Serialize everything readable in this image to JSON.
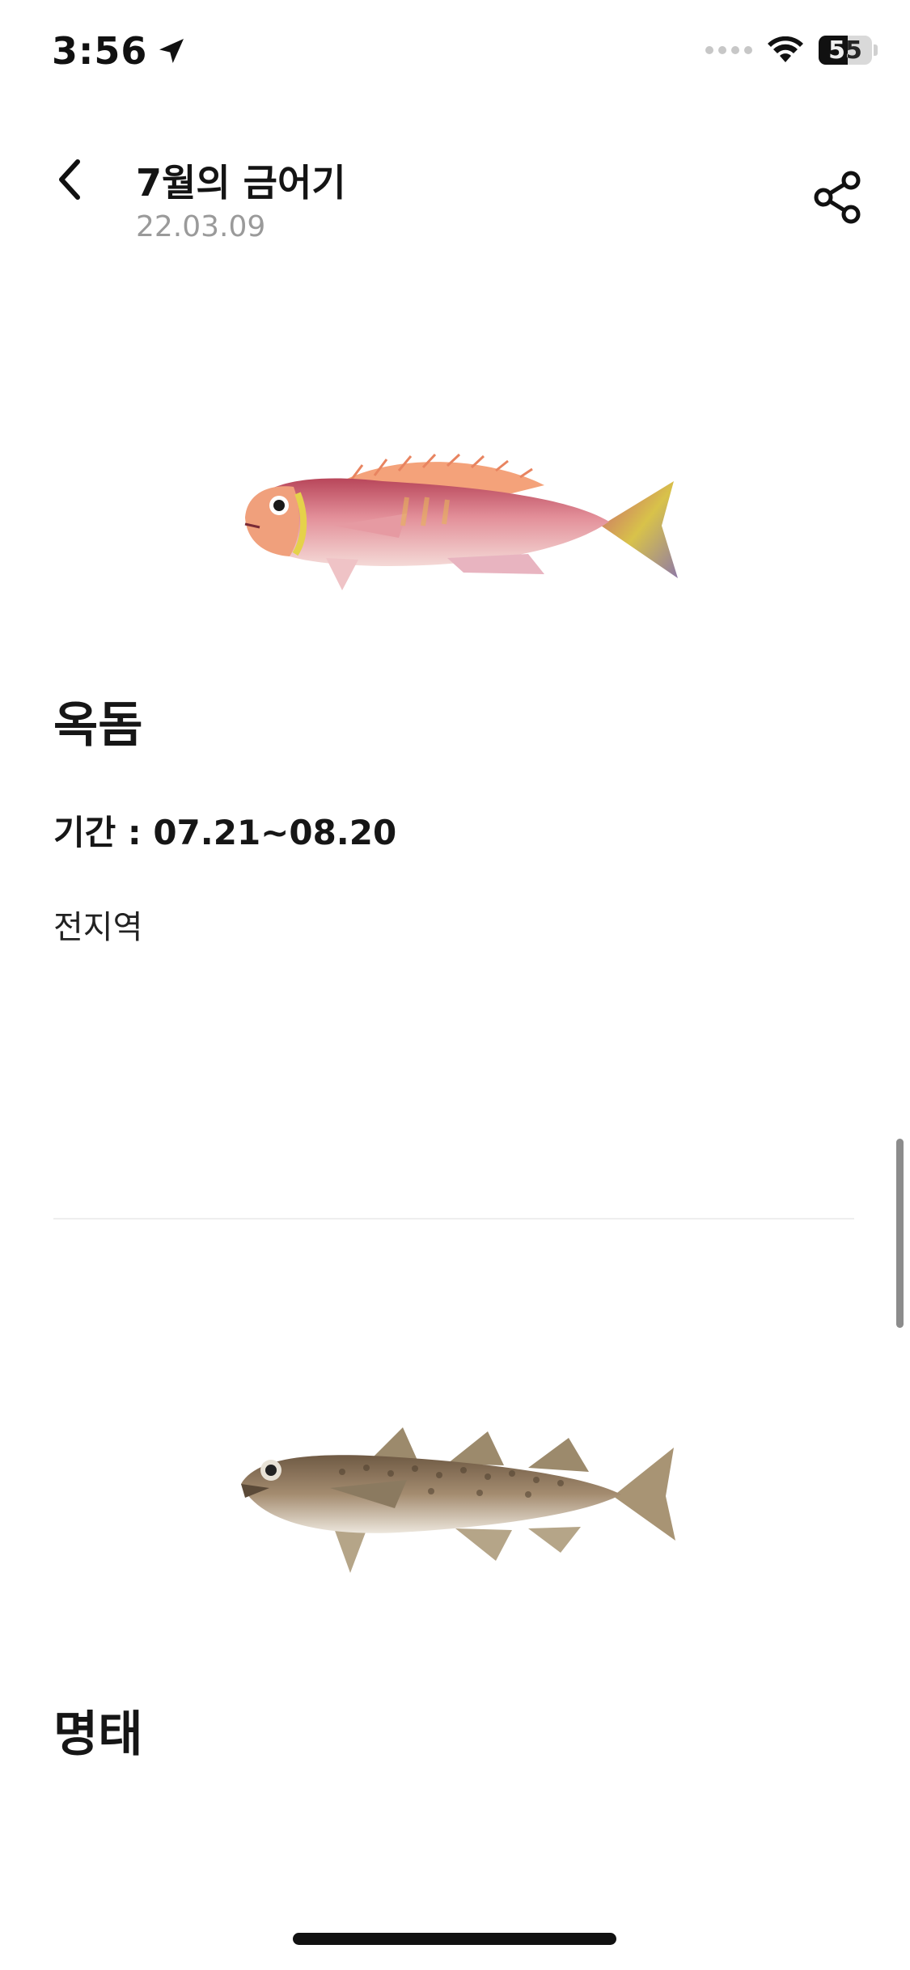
{
  "status_bar": {
    "time": "3:56",
    "battery_level": "55",
    "icons": [
      "location-arrow-icon",
      "cellular-signal-icon",
      "wifi-icon",
      "battery-icon"
    ]
  },
  "header": {
    "title": "7월의 금어기",
    "date": "22.03.09",
    "icons": [
      "back-chevron-icon",
      "share-icon"
    ]
  },
  "items": [
    {
      "name": "옥돔",
      "period": "기간 : 07.21~08.20",
      "region": "전지역",
      "image": "red-tilefish-illustration"
    },
    {
      "name": "명태",
      "image": "pollock-illustration"
    }
  ],
  "colors": {
    "text_primary": "#161616",
    "text_secondary": "#9a9a9a",
    "divider": "#eeeeee"
  }
}
